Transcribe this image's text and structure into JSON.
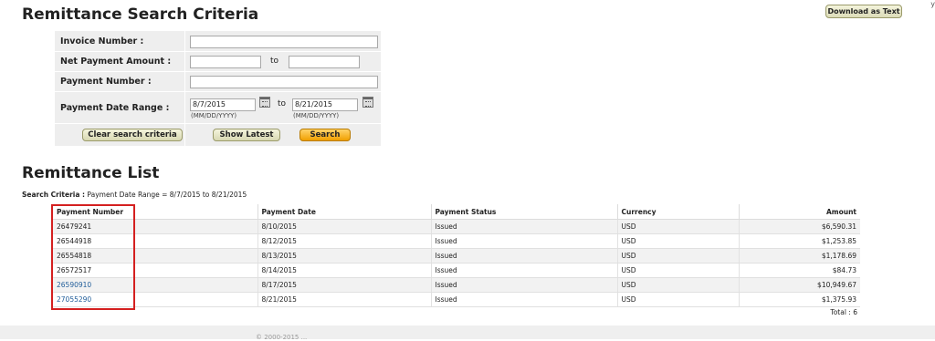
{
  "header": {
    "search_title": "Remittance Search Criteria",
    "download_label": "Download as Text",
    "corner_glyph": "y"
  },
  "form": {
    "invoice_label": "Invoice Number :",
    "invoice_value": "",
    "net_amount_label": "Net Payment Amount :",
    "net_amount_from": "",
    "net_amount_to": "",
    "to_label": "to",
    "payment_number_label": "Payment Number :",
    "payment_number_value": "",
    "date_range_label": "Payment Date Range :",
    "date_from": "8/7/2015",
    "date_to": "8/21/2015",
    "date_hint": "(MM/DD/YYYY)",
    "clear_label": "Clear search criteria",
    "show_latest_label": "Show Latest",
    "search_label": "Search"
  },
  "list": {
    "title": "Remittance List",
    "criteria_label": "Search Criteria :",
    "criteria_value": "Payment Date Range = 8/7/2015 to 8/21/2015",
    "columns": {
      "payment_number": "Payment Number",
      "payment_date": "Payment Date",
      "payment_status": "Payment Status",
      "currency": "Currency",
      "amount": "Amount"
    },
    "rows": [
      {
        "number": "26479241",
        "date": "8/10/2015",
        "status": "Issued",
        "currency": "USD",
        "amount": "$6,590.31"
      },
      {
        "number": "26544918",
        "date": "8/12/2015",
        "status": "Issued",
        "currency": "USD",
        "amount": "$1,253.85"
      },
      {
        "number": "26554818",
        "date": "8/13/2015",
        "status": "Issued",
        "currency": "USD",
        "amount": "$1,178.69"
      },
      {
        "number": "26572517",
        "date": "8/14/2015",
        "status": "Issued",
        "currency": "USD",
        "amount": "$84.73"
      },
      {
        "number": "26590910",
        "date": "8/17/2015",
        "status": "Issued",
        "currency": "USD",
        "amount": "$10,949.67"
      },
      {
        "number": "27055290",
        "date": "8/21/2015",
        "status": "Issued",
        "currency": "USD",
        "amount": "$1,375.93"
      }
    ],
    "total": "Total : 6"
  },
  "footer": {
    "text": "© 2000-2015 ..."
  },
  "colors": {
    "link_visited": "#b2552a",
    "link": "#1f5c99",
    "highlight": "#d42020",
    "search_button": "#f0a000"
  }
}
